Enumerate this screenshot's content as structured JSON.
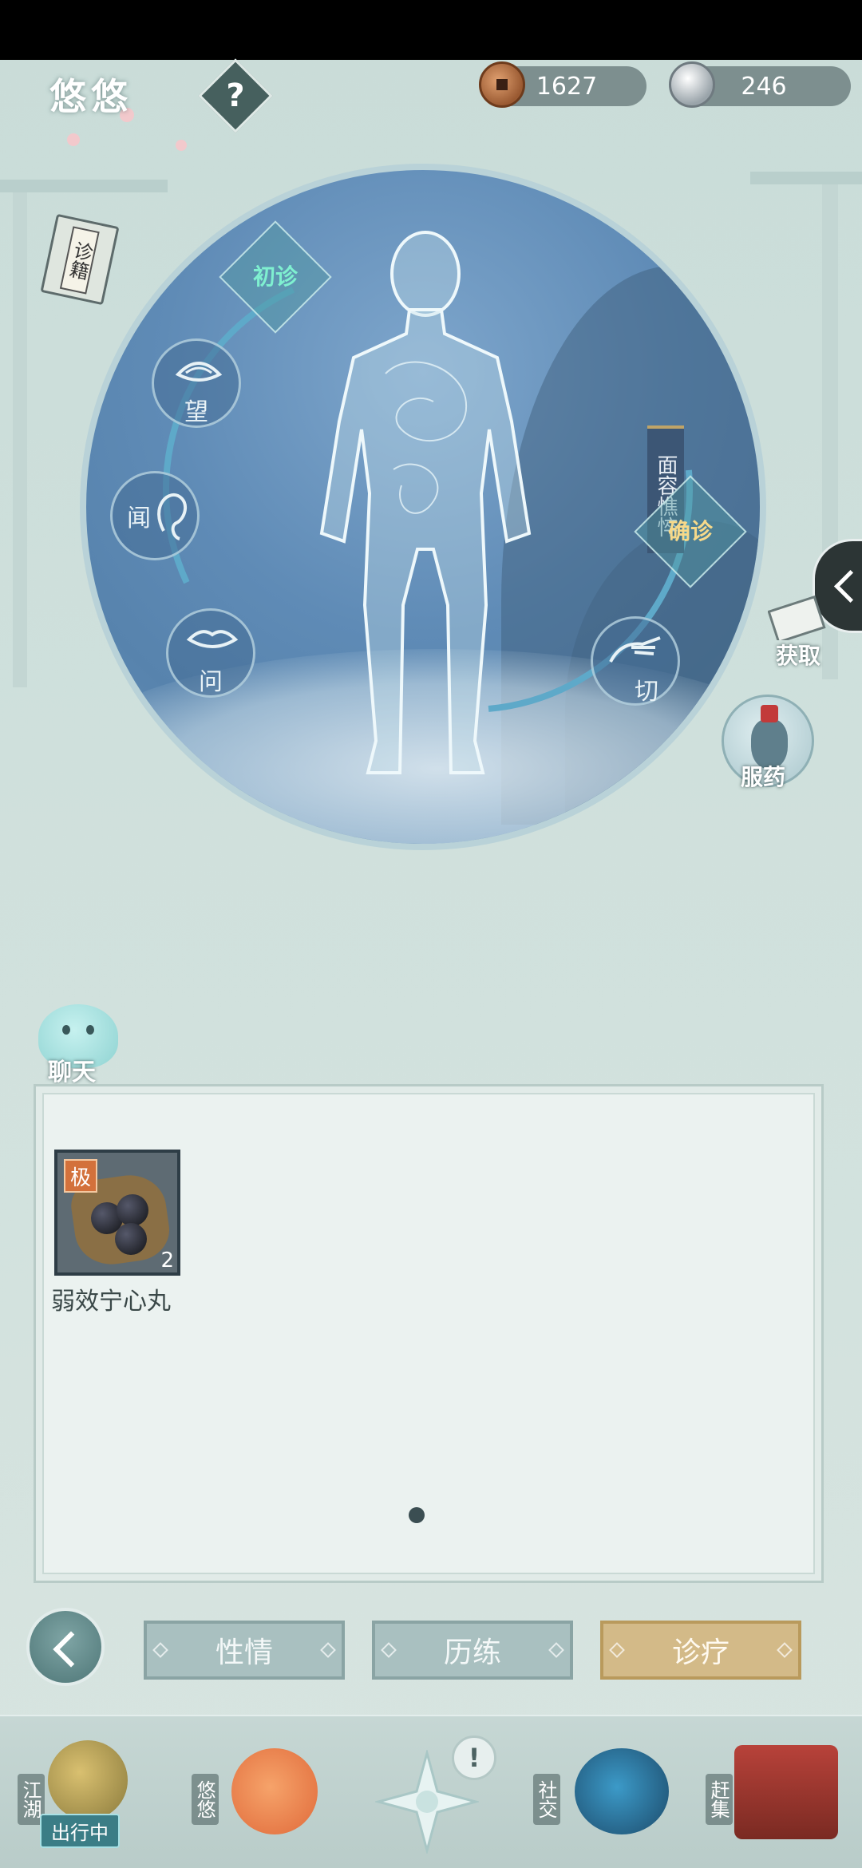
{
  "header": {
    "player_name": "悠悠",
    "help_label": "?",
    "copper_amount": "1627",
    "silver_amount": "246"
  },
  "sidebar": {
    "book_label": "诊籍",
    "obtain_label": "获取",
    "medicine_label": "服药"
  },
  "diagnosis": {
    "initial_label": "初诊",
    "confirm_label": "确诊",
    "symptom_text": "面容憔悴",
    "senses": [
      {
        "label": "望",
        "icon": "eye-icon"
      },
      {
        "label": "闻",
        "icon": "ear-icon"
      },
      {
        "label": "问",
        "icon": "lips-icon"
      },
      {
        "label": "切",
        "icon": "hand-icon"
      }
    ]
  },
  "chat": {
    "label": "聊天"
  },
  "inventory": {
    "items": [
      {
        "name": "弱效宁心丸",
        "grade": "极",
        "count": "2"
      }
    ]
  },
  "tabs": [
    {
      "label": "性情",
      "active": false
    },
    {
      "label": "历练",
      "active": false
    },
    {
      "label": "诊疗",
      "active": true
    }
  ],
  "bottom_nav": {
    "items": [
      {
        "label": "江湖",
        "badge": "出行中"
      },
      {
        "label": "悠悠"
      },
      {
        "label": "社交"
      },
      {
        "label": "赶集"
      }
    ],
    "alert": "!"
  },
  "colors": {
    "active_tab": "#d3ba88",
    "inactive_tab": "#a9c0c0",
    "stage_blue": "#5f8bb6",
    "item_grade": "#d3713b"
  }
}
